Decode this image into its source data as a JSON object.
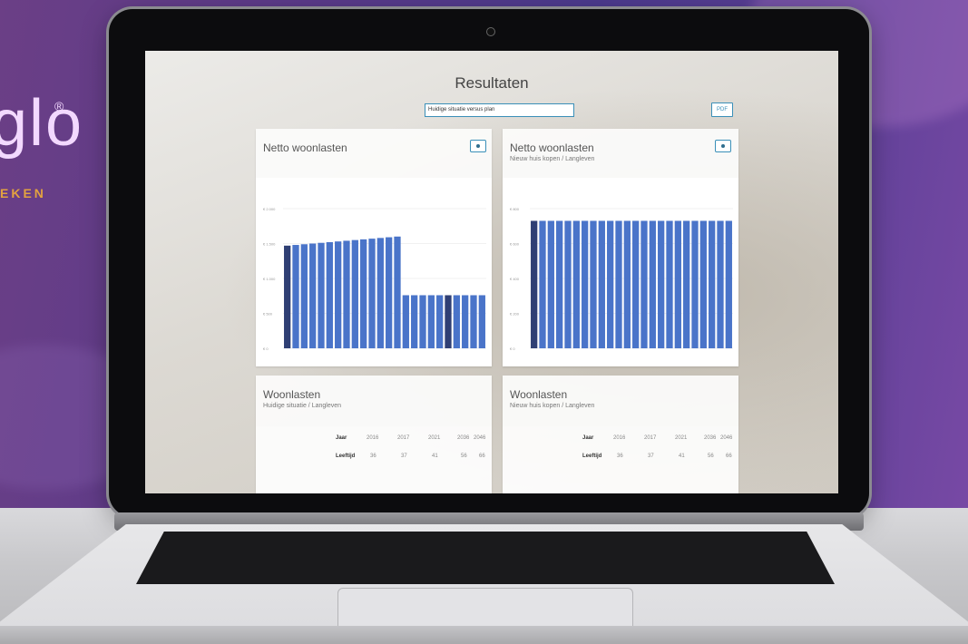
{
  "brand": {
    "logo_text": "glo",
    "registered": "®",
    "tagline": "EKEN"
  },
  "app": {
    "title": "Resultaten",
    "scenario_select": "Huidige situatie versus plan",
    "pdf_label": "PDF"
  },
  "panels": {
    "left_chart": {
      "title": "Netto woonlasten",
      "subtitle": ""
    },
    "right_chart": {
      "title": "Netto woonlasten",
      "subtitle": "Nieuw huis kopen / Langleven"
    },
    "left_table": {
      "title": "Woonlasten",
      "subtitle": "Huidige situatie / Langleven"
    },
    "right_table": {
      "title": "Woonlasten",
      "subtitle": "Nieuw huis kopen / Langleven"
    }
  },
  "table": {
    "row1_label": "Jaar",
    "row2_label": "Leeftijd",
    "years": [
      "2016",
      "2017",
      "2021",
      "2036",
      "2046"
    ],
    "ages": [
      "36",
      "37",
      "41",
      "56",
      "66"
    ]
  },
  "colors": {
    "bar": "#4a74c9",
    "bar_dark": "#2f3f74",
    "accent": "#3a8fb8"
  },
  "chart_data": [
    {
      "type": "bar",
      "title": "Netto woonlasten",
      "yticks": [
        "€ 0",
        "€ 500",
        "€ 1.000",
        "€ 1.500",
        "€ 2.000"
      ],
      "ylim": [
        0,
        2000
      ],
      "values": [
        1470,
        1480,
        1490,
        1500,
        1510,
        1520,
        1530,
        1540,
        1550,
        1560,
        1570,
        1580,
        1590,
        1600,
        760,
        760,
        760,
        760,
        760,
        760,
        760,
        760,
        760,
        760
      ],
      "dark_indices": [
        0,
        19
      ]
    },
    {
      "type": "bar",
      "title": "Netto woonlasten",
      "subtitle": "Nieuw huis kopen / Langleven",
      "yticks": [
        "€ 0",
        "€ 200",
        "€ 400",
        "€ 600",
        "€ 800"
      ],
      "ylim": [
        0,
        800
      ],
      "values": [
        730,
        730,
        730,
        730,
        730,
        730,
        730,
        730,
        730,
        730,
        730,
        730,
        730,
        730,
        730,
        730,
        730,
        730,
        730,
        730,
        730,
        730,
        730,
        730
      ],
      "dark_indices": [
        0
      ]
    }
  ]
}
